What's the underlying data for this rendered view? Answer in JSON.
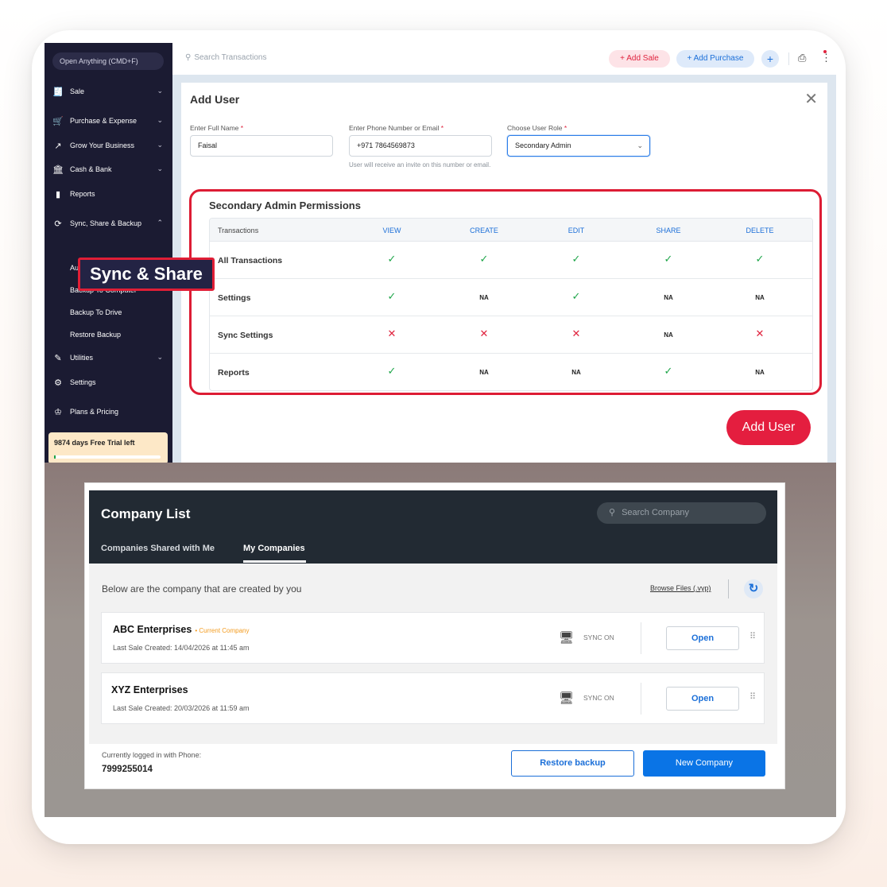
{
  "sidebar": {
    "open_anything": "Open Anything (CMD+F)",
    "items": [
      {
        "label": "Sale",
        "icon": "receipt-icon"
      },
      {
        "label": "Purchase & Expense",
        "icon": "cart-icon"
      },
      {
        "label": "Grow Your Business",
        "icon": "trend-icon"
      },
      {
        "label": "Cash & Bank",
        "icon": "bank-icon"
      },
      {
        "label": "Reports",
        "icon": "bar-chart-icon"
      },
      {
        "label": "Sync, Share & Backup",
        "icon": "sync-icon"
      },
      {
        "label": "Utilities",
        "icon": "tools-icon"
      },
      {
        "label": "Settings",
        "icon": "gear-icon"
      },
      {
        "label": "Plans & Pricing",
        "icon": "crown-icon"
      }
    ],
    "sub_items": [
      "Auto Backup",
      "Backup To Computer",
      "Backup To Drive",
      "Restore Backup"
    ],
    "callout": "Sync & Share",
    "trial": {
      "text": "9874 days Free Trial left",
      "progress": 0.01
    }
  },
  "topbar": {
    "search_placeholder": "Search Transactions",
    "add_sale": "+ Add Sale",
    "add_purchase": "+ Add Purchase",
    "plus": "+"
  },
  "add_user": {
    "title": "Add User",
    "name_label": "Enter Full Name",
    "name_value": "Faisal",
    "phone_label": "Enter Phone Number or Email",
    "phone_value": "+971 7864569873",
    "phone_hint": "User will receive an invite on this number or email.",
    "role_label": "Choose User Role",
    "role_value": "Secondary Admin",
    "required_mark": "*",
    "submit": "Add User"
  },
  "permissions": {
    "title": "Secondary Admin Permissions",
    "columns": [
      "Transactions",
      "VIEW",
      "CREATE",
      "EDIT",
      "SHARE",
      "DELETE"
    ],
    "rows": [
      {
        "name": "All Transactions",
        "cells": [
          "check",
          "check",
          "check",
          "check",
          "check"
        ]
      },
      {
        "name": "Settings",
        "cells": [
          "check",
          "NA",
          "check",
          "NA",
          "NA"
        ]
      },
      {
        "name": "Sync Settings",
        "cells": [
          "cross",
          "cross",
          "cross",
          "NA",
          "cross"
        ]
      },
      {
        "name": "Reports",
        "cells": [
          "check",
          "NA",
          "NA",
          "check",
          "NA"
        ]
      }
    ],
    "na_label": "NA"
  },
  "company_list": {
    "title": "Company List",
    "search_placeholder": "Search Company",
    "tabs": [
      "Companies Shared with Me",
      "My Companies"
    ],
    "active_tab": "My Companies",
    "description": "Below are the company that are created by you",
    "browse": "Browse Files (.vyp)",
    "companies": [
      {
        "name": "ABC Enterprises",
        "badge": "• Current Company",
        "last_sale": "Last Sale Created: 14/04/2026 at 11:45 am",
        "sync": "SYNC ON",
        "open": "Open"
      },
      {
        "name": "XYZ Enterprises",
        "badge": "",
        "last_sale": "Last Sale Created: 20/03/2026 at 11:59 am",
        "sync": "SYNC ON",
        "open": "Open"
      }
    ],
    "footer": {
      "logged_label": "Currently logged in with Phone:",
      "phone": "7999255014",
      "restore": "Restore backup",
      "new_company": "New Company"
    }
  },
  "colors": {
    "accent_red": "#e41e3f",
    "accent_blue": "#1b6fd8",
    "sidebar_bg": "#1b1b32",
    "check_green": "#1fa64a"
  }
}
